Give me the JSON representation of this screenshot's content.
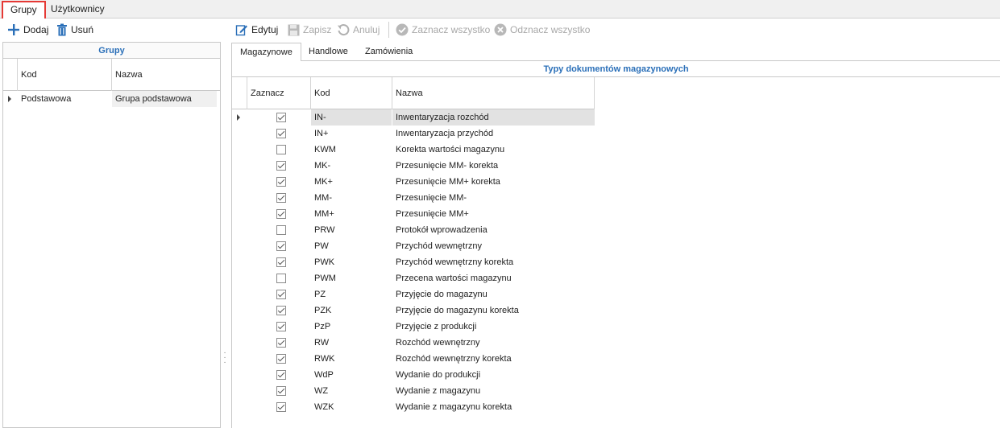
{
  "top_tabs": [
    {
      "label": "Grupy",
      "active": true
    },
    {
      "label": "Użytkownicy",
      "active": false
    }
  ],
  "toolbar": {
    "add_label": "Dodaj",
    "delete_label": "Usuń",
    "edit_label": "Edytuj",
    "save_label": "Zapisz",
    "cancel_label": "Anuluj",
    "select_all_label": "Zaznacz wszystko",
    "deselect_all_label": "Odznacz wszystko"
  },
  "groups_panel": {
    "title": "Grupy",
    "columns": [
      "Kod",
      "Nazwa"
    ],
    "rows": [
      {
        "code": "Podstawowa",
        "name": "Grupa podstawowa"
      }
    ]
  },
  "doc_tabs": [
    {
      "label": "Magazynowe",
      "active": true
    },
    {
      "label": "Handlowe",
      "active": false
    },
    {
      "label": "Zamówienia",
      "active": false
    }
  ],
  "doc_grid": {
    "title": "Typy dokumentów magazynowych",
    "columns": [
      "Zaznacz",
      "Kod",
      "Nazwa"
    ],
    "rows": [
      {
        "checked": true,
        "code": "IN-",
        "name": "Inwentaryzacja rozchód"
      },
      {
        "checked": true,
        "code": "IN+",
        "name": "Inwentaryzacja przychód"
      },
      {
        "checked": false,
        "code": "KWM",
        "name": "Korekta wartości magazynu"
      },
      {
        "checked": true,
        "code": "MK-",
        "name": "Przesunięcie MM- korekta"
      },
      {
        "checked": true,
        "code": "MK+",
        "name": "Przesunięcie MM+ korekta"
      },
      {
        "checked": true,
        "code": "MM-",
        "name": "Przesunięcie MM-"
      },
      {
        "checked": true,
        "code": "MM+",
        "name": "Przesunięcie MM+"
      },
      {
        "checked": false,
        "code": "PRW",
        "name": "Protokół wprowadzenia"
      },
      {
        "checked": true,
        "code": "PW",
        "name": "Przychód wewnętrzny"
      },
      {
        "checked": true,
        "code": "PWK",
        "name": "Przychód wewnętrzny korekta"
      },
      {
        "checked": false,
        "code": "PWM",
        "name": "Przecena wartości magazynu"
      },
      {
        "checked": true,
        "code": "PZ",
        "name": "Przyjęcie do magazynu"
      },
      {
        "checked": true,
        "code": "PZK",
        "name": "Przyjęcie do magazynu korekta"
      },
      {
        "checked": true,
        "code": "PzP",
        "name": "Przyjęcie z produkcji"
      },
      {
        "checked": true,
        "code": "RW",
        "name": "Rozchód wewnętrzny"
      },
      {
        "checked": true,
        "code": "RWK",
        "name": "Rozchód wewnętrzny korekta"
      },
      {
        "checked": true,
        "code": "WdP",
        "name": "Wydanie do produkcji"
      },
      {
        "checked": true,
        "code": "WZ",
        "name": "Wydanie z magazynu"
      },
      {
        "checked": true,
        "code": "WZK",
        "name": "Wydanie z magazynu korekta"
      }
    ]
  },
  "colors": {
    "accent": "#2a6fb8",
    "active_tab_border": "#e53935"
  },
  "icons": [
    "plus-icon",
    "trash-icon",
    "edit-icon",
    "save-icon",
    "undo-icon",
    "check-circle-icon",
    "x-circle-icon"
  ]
}
